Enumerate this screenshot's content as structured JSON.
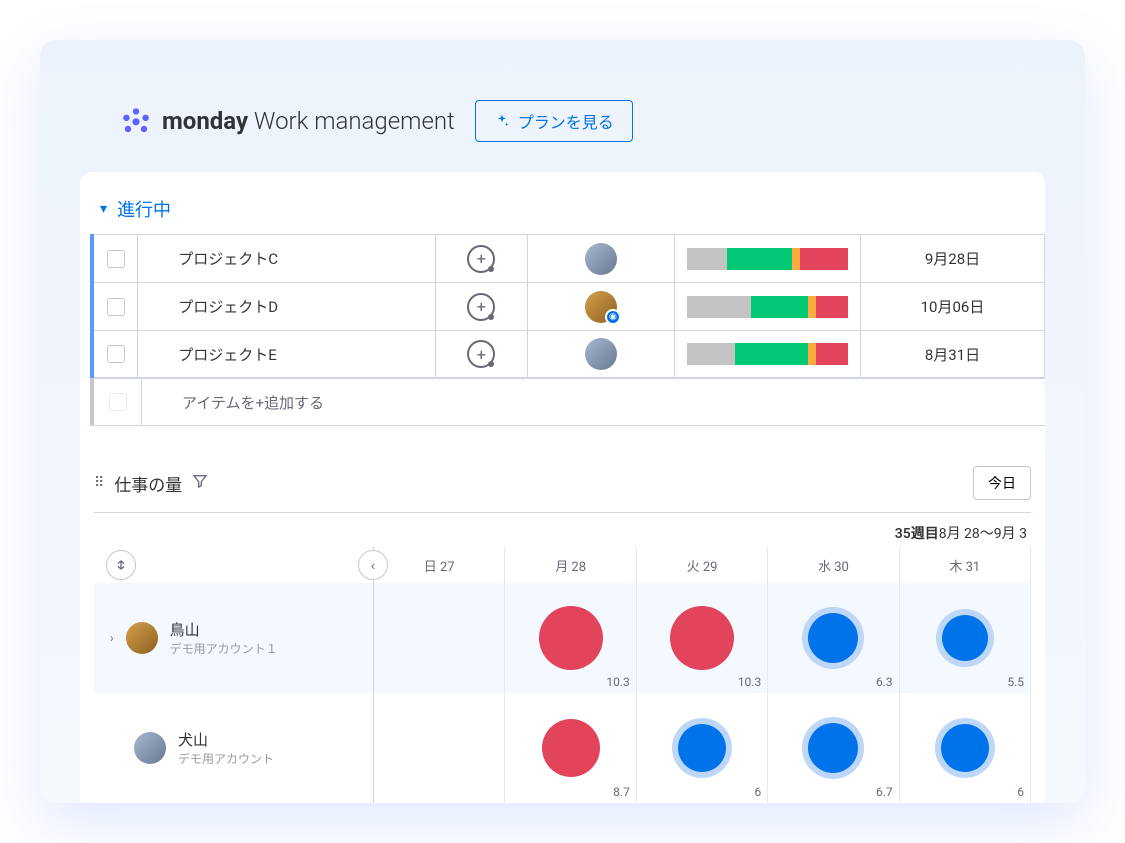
{
  "header": {
    "brand_bold": "monday",
    "brand_light": " Work management",
    "plan_button": "プランを見る"
  },
  "section": {
    "title": "進行中",
    "rows": [
      {
        "name": "プロジェクトC",
        "date": "9月28日",
        "avatar": "dog",
        "progress": [
          25,
          40,
          5,
          30
        ]
      },
      {
        "name": "プロジェクトD",
        "date": "10月06日",
        "avatar": "bird",
        "eye": true,
        "progress": [
          40,
          35,
          5,
          20
        ]
      },
      {
        "name": "プロジェクトE",
        "date": "8月31日",
        "avatar": "dog",
        "progress": [
          30,
          45,
          5,
          20
        ]
      }
    ],
    "add_item": "アイテムを+追加する"
  },
  "workload": {
    "title": "仕事の量",
    "today_button": "今日",
    "week_num": "35週目",
    "week_range": "8月 28〜9月 3",
    "dates": [
      {
        "label": "日 27"
      },
      {
        "label": "月 28"
      },
      {
        "label": "火 29"
      },
      {
        "label": "水 30"
      },
      {
        "label": "木 31"
      }
    ],
    "people": [
      {
        "name": "鳥山",
        "sub": "デモ用アカウント１",
        "avatar": "bird",
        "selected": true,
        "expand": true,
        "bubbles": [
          null,
          {
            "color": "red",
            "size": 64,
            "value": "10.3"
          },
          {
            "color": "red",
            "size": 64,
            "value": "10.3"
          },
          {
            "color": "blue",
            "size": 50,
            "ring": true,
            "value": "6.3"
          },
          {
            "color": "blue",
            "size": 46,
            "ring": true,
            "value": "5.5"
          }
        ]
      },
      {
        "name": "犬山",
        "sub": "デモ用アカウント",
        "avatar": "dog",
        "bubbles": [
          null,
          {
            "color": "red",
            "size": 58,
            "value": "8.7"
          },
          {
            "color": "blue",
            "size": 48,
            "ring": true,
            "value": "6"
          },
          {
            "color": "blue",
            "size": 50,
            "ring": true,
            "value": "6.7"
          },
          {
            "color": "blue",
            "size": 48,
            "ring": true,
            "value": "6"
          }
        ]
      }
    ]
  }
}
